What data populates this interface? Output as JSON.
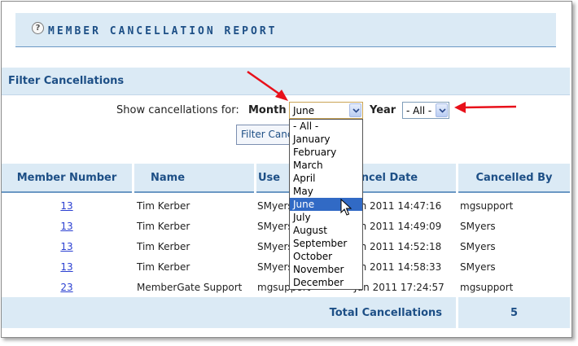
{
  "header": {
    "title": "MEMBER CANCELLATION REPORT",
    "help_icon": "?"
  },
  "filter": {
    "section_title": "Filter Cancellations",
    "show_label": "Show cancellations for:",
    "month_label": "Month",
    "month_value": "June",
    "year_label": "Year",
    "year_value": "- All -",
    "button_label": "Filter Canc"
  },
  "month_options": [
    "- All -",
    "January",
    "February",
    "March",
    "April",
    "May",
    "June",
    "July",
    "August",
    "September",
    "October",
    "November",
    "December"
  ],
  "month_selected_index": 6,
  "table": {
    "columns": [
      "Member Number",
      "Name",
      "Use",
      "ancel Date",
      "Cancelled By"
    ],
    "rows": [
      {
        "member": "13",
        "name": "Tim Kerber",
        "user": "SMyers",
        "date": "un 2011 14:47:16",
        "by": "mgsupport"
      },
      {
        "member": "13",
        "name": "Tim Kerber",
        "user": "SMyers",
        "date": "un 2011 14:49:09",
        "by": "SMyers"
      },
      {
        "member": "13",
        "name": "Tim Kerber",
        "user": "SMyers",
        "date": "un 2011 14:52:18",
        "by": "SMyers"
      },
      {
        "member": "13",
        "name": "Tim Kerber",
        "user": "SMyers",
        "date": "un 2011 14:58:33",
        "by": "SMyers"
      },
      {
        "member": "23",
        "name": "MemberGate Support",
        "user": "mgsupport",
        "date": "Jun 2011 17:24:57",
        "by": "mgsupport"
      }
    ]
  },
  "totals": {
    "label": "Total Cancellations",
    "value": "5"
  },
  "colors": {
    "accent": "#1d4f86",
    "panel": "#dbeaf5",
    "highlight": "#316ac5",
    "annotation": "#e8101a"
  }
}
